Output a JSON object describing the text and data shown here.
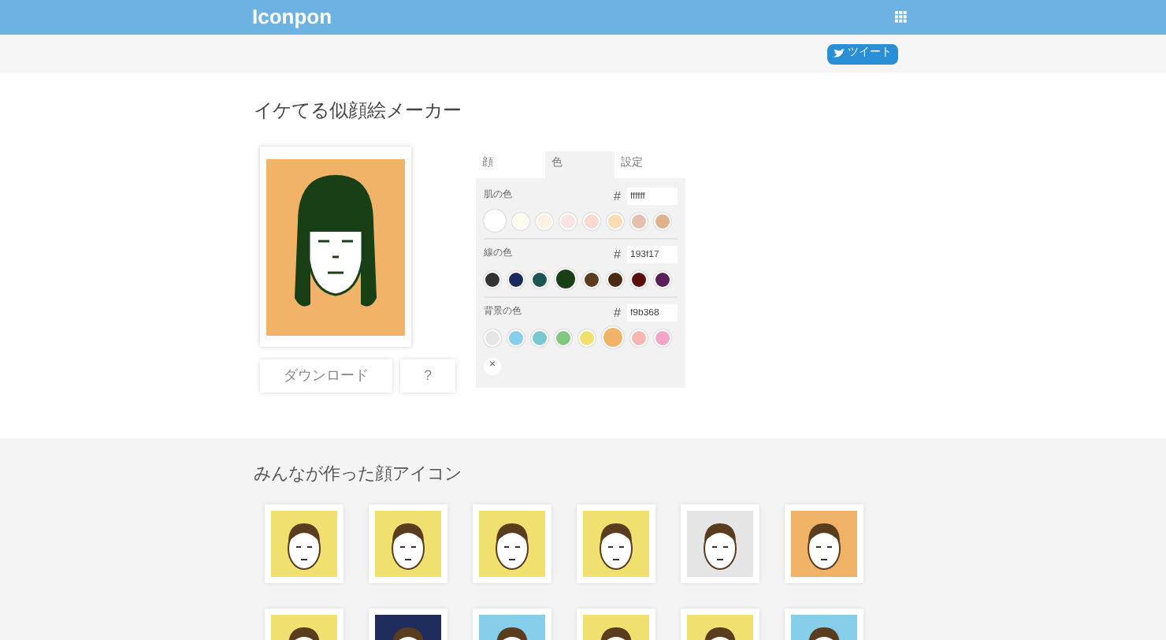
{
  "header": {
    "logo": "Iconpon"
  },
  "share": {
    "tweet": "ツイート"
  },
  "maker": {
    "title": "イケてる似顔絵メーカー",
    "download": "ダウンロード",
    "help": "?"
  },
  "tabs": [
    {
      "label": "顔",
      "selected": false
    },
    {
      "label": "色",
      "selected": true
    },
    {
      "label": "設定",
      "selected": false
    }
  ],
  "color_groups": [
    {
      "label": "肌の色",
      "hash": "#",
      "value": "ffffff",
      "swatches": [
        {
          "color": "#ffffff",
          "selected": true
        },
        {
          "color": "#fdfbe9",
          "selected": false
        },
        {
          "color": "#fdf1e1",
          "selected": false
        },
        {
          "color": "#fde3e3",
          "selected": false
        },
        {
          "color": "#fbd8d0",
          "selected": false
        },
        {
          "color": "#fbdcb5",
          "selected": false
        },
        {
          "color": "#e6c0ae",
          "selected": false
        },
        {
          "color": "#dfb28d",
          "selected": false
        }
      ]
    },
    {
      "label": "線の色",
      "hash": "#",
      "value": "193f17",
      "swatches": [
        {
          "color": "#333333",
          "selected": false
        },
        {
          "color": "#1a2a5c",
          "selected": false
        },
        {
          "color": "#1d5452",
          "selected": false
        },
        {
          "color": "#193f17",
          "selected": true
        },
        {
          "color": "#5a3d1e",
          "selected": false
        },
        {
          "color": "#4a2a12",
          "selected": false
        },
        {
          "color": "#5a0e0e",
          "selected": false
        },
        {
          "color": "#5a1f5a",
          "selected": false
        }
      ]
    },
    {
      "label": "背景の色",
      "hash": "#",
      "value": "f9b368",
      "clear": "×",
      "swatches": [
        {
          "color": "#e5e5e5",
          "selected": false
        },
        {
          "color": "#87ceeb",
          "selected": false
        },
        {
          "color": "#77c9cf",
          "selected": false
        },
        {
          "color": "#82c87e",
          "selected": false
        },
        {
          "color": "#f0e070",
          "selected": false
        },
        {
          "color": "#f0b368",
          "selected": true
        },
        {
          "color": "#f6b6b2",
          "selected": false
        },
        {
          "color": "#f2a5c6",
          "selected": false
        }
      ]
    }
  ],
  "gallery": {
    "title": "みんなが作った顔アイコン",
    "icons": [
      {
        "color": "#f0e070"
      },
      {
        "color": "#f0e070"
      },
      {
        "color": "#f0e070"
      },
      {
        "color": "#f0e070"
      },
      {
        "color": "#e5e5e5"
      },
      {
        "color": "#f0b368"
      },
      {
        "color": "#f0e070"
      },
      {
        "color": "#1f2d5c"
      },
      {
        "color": "#87ceeb"
      },
      {
        "color": "#f0e070"
      },
      {
        "color": "#f0e070"
      },
      {
        "color": "#87ceeb"
      }
    ]
  }
}
